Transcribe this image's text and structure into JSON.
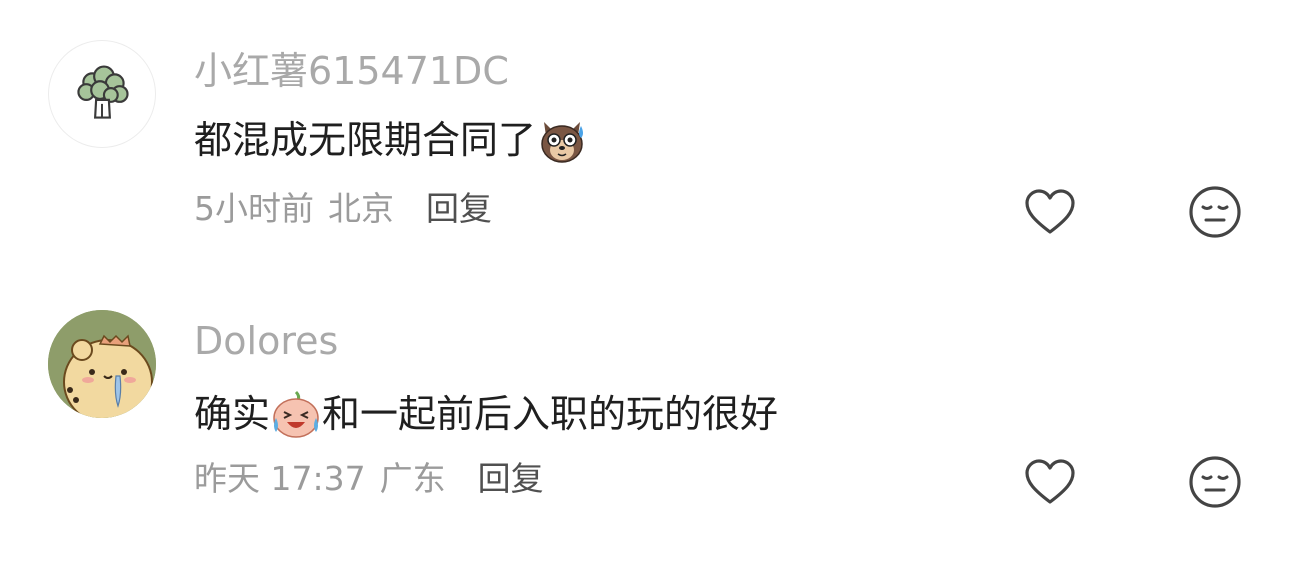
{
  "comments": [
    {
      "username": "小红薯615471DC",
      "avatar_icon": "broccoli-avatar",
      "text": "都混成无限期合同了",
      "text_after_emoji": "",
      "emoji_icon": "dog-sweat-emoji",
      "time": "5小时前",
      "location": "北京",
      "reply_label": "回复",
      "like_icon": "heart-icon",
      "dislike_icon": "neutral-face-icon"
    },
    {
      "username": "Dolores",
      "avatar_icon": "bear-crying-avatar",
      "text": "确实",
      "text_after_emoji": "和一起前后入职的玩的很好",
      "emoji_icon": "laughing-tears-emoji",
      "time": "昨天 17:37",
      "location": "广东",
      "reply_label": "回复",
      "like_icon": "heart-icon",
      "dislike_icon": "neutral-face-icon"
    }
  ],
  "colors": {
    "username": "#a9a9a9",
    "content": "#1f1f1f",
    "meta": "#9b9b9b",
    "reply": "#505050",
    "icon_stroke": "#444444"
  }
}
